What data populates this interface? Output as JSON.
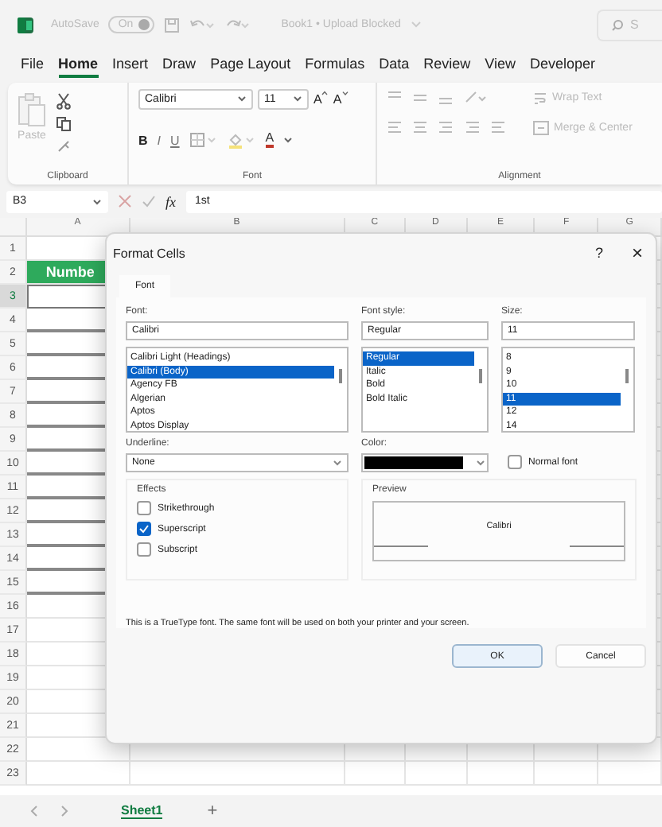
{
  "title_bar": {
    "autosave_label": "AutoSave",
    "autosave_toggle": {
      "label": "On",
      "on": true
    },
    "document_title": "Book1 • Upload Blocked",
    "search": {
      "placeholder": "S"
    }
  },
  "menu_tabs": [
    {
      "label": "File",
      "selected": false
    },
    {
      "label": "Home",
      "selected": true
    },
    {
      "label": "Insert",
      "selected": false
    },
    {
      "label": "Draw",
      "selected": false
    },
    {
      "label": "Page Layout",
      "selected": false
    },
    {
      "label": "Formulas",
      "selected": false
    },
    {
      "label": "Data",
      "selected": false
    },
    {
      "label": "Review",
      "selected": false
    },
    {
      "label": "View",
      "selected": false
    },
    {
      "label": "Developer",
      "selected": false
    }
  ],
  "ribbon": {
    "clipboard": {
      "paste_label": "Paste",
      "group_label": "Clipboard"
    },
    "font": {
      "font_name": "Calibri",
      "font_size": "11",
      "grow_font": "A",
      "shrink_font": "A",
      "bold": "B",
      "italic": "I",
      "underline": "U",
      "font_color": "A",
      "group_label": "Font"
    },
    "alignment": {
      "wrap_text": "Wrap Text",
      "merge_center": "Merge & Center",
      "group_label": "Alignment"
    }
  },
  "formula_bar": {
    "name_box": "B3",
    "fx": "fx",
    "value": "1st"
  },
  "sheet": {
    "columns": [
      "A",
      "B",
      "C",
      "D",
      "E",
      "F",
      "G"
    ],
    "rows": [
      {
        "number": "1",
        "kind": "plain",
        "selected": false
      },
      {
        "number": "2",
        "kind": "header",
        "cell_a": "Numbe",
        "selected": false
      },
      {
        "number": "3",
        "kind": "bordered",
        "selected": true
      },
      {
        "number": "4",
        "kind": "bordered",
        "selected": false
      },
      {
        "number": "5",
        "kind": "bordered",
        "selected": false
      },
      {
        "number": "6",
        "kind": "bordered",
        "selected": false
      },
      {
        "number": "7",
        "kind": "bordered",
        "selected": false
      },
      {
        "number": "8",
        "kind": "bordered",
        "selected": false
      },
      {
        "number": "9",
        "kind": "bordered",
        "selected": false
      },
      {
        "number": "10",
        "kind": "bordered",
        "selected": false
      },
      {
        "number": "11",
        "kind": "bordered",
        "selected": false
      },
      {
        "number": "12",
        "kind": "bordered",
        "selected": false
      },
      {
        "number": "13",
        "kind": "bordered",
        "selected": false
      },
      {
        "number": "14",
        "kind": "bordered",
        "selected": false
      },
      {
        "number": "15",
        "kind": "bordered",
        "selected": false
      },
      {
        "number": "16",
        "kind": "plain",
        "selected": false
      },
      {
        "number": "17",
        "kind": "plain",
        "selected": false
      },
      {
        "number": "18",
        "kind": "plain",
        "selected": false
      },
      {
        "number": "19",
        "kind": "plain",
        "selected": false
      },
      {
        "number": "20",
        "kind": "plain",
        "selected": false
      },
      {
        "number": "21",
        "kind": "plain",
        "selected": false
      },
      {
        "number": "22",
        "kind": "plain",
        "selected": false
      },
      {
        "number": "23",
        "kind": "plain",
        "selected": false
      }
    ]
  },
  "sheet_tabs": {
    "tabs": [
      {
        "label": "Sheet1",
        "selected": true
      }
    ],
    "add": "+"
  },
  "dialog": {
    "title": "Format Cells",
    "help": "?",
    "close": "×",
    "tabs": [
      {
        "label": "Font",
        "selected": true
      }
    ],
    "font": {
      "label": "Font:",
      "value": "Calibri",
      "items": [
        {
          "label": "Calibri Light (Headings)",
          "selected": false
        },
        {
          "label": "Calibri (Body)",
          "selected": true
        },
        {
          "label": "Agency FB",
          "selected": false
        },
        {
          "label": "Algerian",
          "selected": false
        },
        {
          "label": "Aptos",
          "selected": false
        },
        {
          "label": "Aptos Display",
          "selected": false
        }
      ]
    },
    "font_style": {
      "label": "Font style:",
      "value": "Regular",
      "items": [
        {
          "label": "Regular",
          "selected": true
        },
        {
          "label": "Italic",
          "selected": false
        },
        {
          "label": "Bold",
          "selected": false
        },
        {
          "label": "Bold Italic",
          "selected": false
        }
      ]
    },
    "size": {
      "label": "Size:",
      "value": "11",
      "items": [
        {
          "label": "8",
          "selected": false
        },
        {
          "label": "9",
          "selected": false
        },
        {
          "label": "10",
          "selected": false
        },
        {
          "label": "11",
          "selected": true
        },
        {
          "label": "12",
          "selected": false
        },
        {
          "label": "14",
          "selected": false
        }
      ]
    },
    "underline": {
      "label": "Underline:",
      "value": "None"
    },
    "color": {
      "label": "Color:",
      "color": "#000000"
    },
    "normal_font": {
      "label": "Normal font",
      "checked": false
    },
    "effects": {
      "label": "Effects",
      "items": [
        {
          "label": "Strikethrough",
          "checked": false
        },
        {
          "label": "Superscript",
          "checked": true
        },
        {
          "label": "Subscript",
          "checked": false
        }
      ]
    },
    "preview": {
      "label": "Preview",
      "sample": "Calibri"
    },
    "description": "This is a TrueType font.  The same font will be used on both your printer and your screen.",
    "buttons": [
      {
        "label": "OK",
        "kind": "default"
      },
      {
        "label": "Cancel",
        "kind": "normal"
      }
    ]
  }
}
